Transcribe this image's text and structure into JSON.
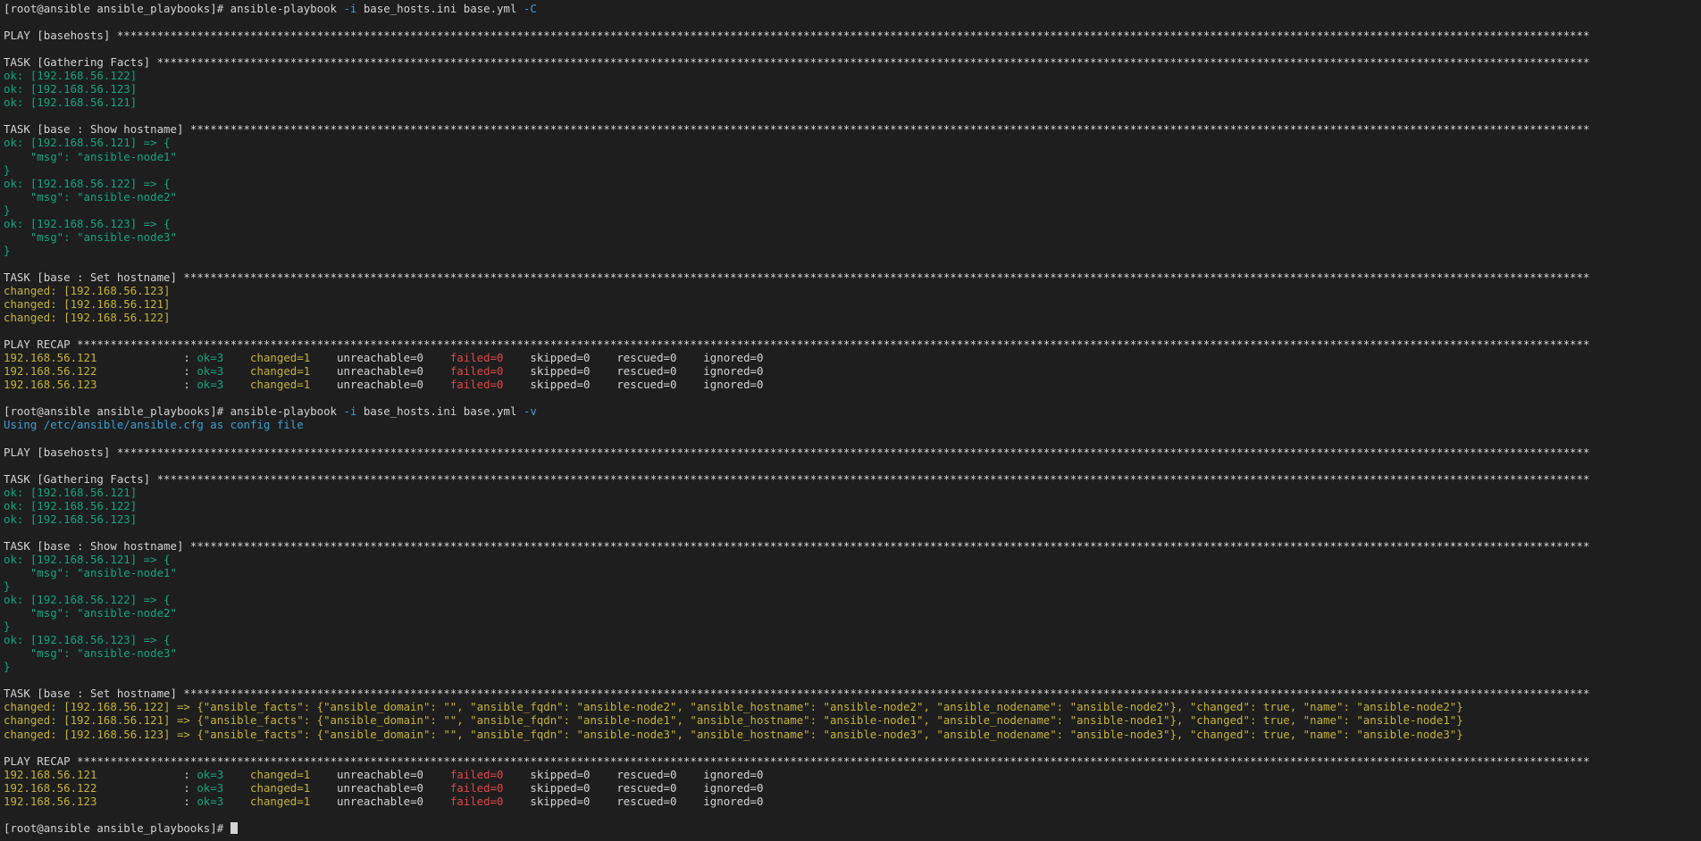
{
  "colors": {
    "background": "#1e1e1e",
    "default": "#d4d4d4",
    "ok": "#13a57e",
    "changed": "#c4b33a",
    "failed": "#e04646",
    "info": "#3a9fd4",
    "flag": "#3a9fd4"
  },
  "terminal": {
    "cursor_icon": "block-cursor-icon",
    "lines": [
      [
        [
          "[root@ansible ansible_playbooks]# ansible-playbook ",
          "default"
        ],
        [
          "-i",
          "flag"
        ],
        [
          " base_hosts.ini base.yml ",
          "default"
        ],
        [
          "-C",
          "flag"
        ]
      ],
      [],
      [
        [
          "PLAY [basehosts] *****************************************************************************************************************************************************************************************************************************",
          "default"
        ]
      ],
      [],
      [
        [
          "TASK [Gathering Facts] ***********************************************************************************************************************************************************************************************************************",
          "default"
        ]
      ],
      [
        [
          "ok: [192.168.56.122]",
          "ok"
        ]
      ],
      [
        [
          "ok: [192.168.56.123]",
          "ok"
        ]
      ],
      [
        [
          "ok: [192.168.56.121]",
          "ok"
        ]
      ],
      [],
      [
        [
          "TASK [base : Show hostname] ******************************************************************************************************************************************************************************************************************",
          "default"
        ]
      ],
      [
        [
          "ok: [192.168.56.121] => {",
          "ok"
        ]
      ],
      [
        [
          "    \"msg\": \"ansible-node1\"",
          "ok"
        ]
      ],
      [
        [
          "}",
          "ok"
        ]
      ],
      [
        [
          "ok: [192.168.56.122] => {",
          "ok"
        ]
      ],
      [
        [
          "    \"msg\": \"ansible-node2\"",
          "ok"
        ]
      ],
      [
        [
          "}",
          "ok"
        ]
      ],
      [
        [
          "ok: [192.168.56.123] => {",
          "ok"
        ]
      ],
      [
        [
          "    \"msg\": \"ansible-node3\"",
          "ok"
        ]
      ],
      [
        [
          "}",
          "ok"
        ]
      ],
      [],
      [
        [
          "TASK [base : Set hostname] *******************************************************************************************************************************************************************************************************************",
          "default"
        ]
      ],
      [
        [
          "changed: [192.168.56.123]",
          "changed"
        ]
      ],
      [
        [
          "changed: [192.168.56.121]",
          "changed"
        ]
      ],
      [
        [
          "changed: [192.168.56.122]",
          "changed"
        ]
      ],
      [],
      [
        [
          "PLAY RECAP ***********************************************************************************************************************************************************************************************************************************",
          "default"
        ]
      ],
      [
        [
          "192.168.56.121",
          "changed"
        ],
        [
          "             : ",
          "default"
        ],
        [
          "ok=3",
          "ok"
        ],
        [
          "    ",
          "default"
        ],
        [
          "changed=1",
          "changed"
        ],
        [
          "    unreachable=0    ",
          "default"
        ],
        [
          "failed=0",
          "failed"
        ],
        [
          "    skipped=0    rescued=0    ignored=0",
          "default"
        ]
      ],
      [
        [
          "192.168.56.122",
          "changed"
        ],
        [
          "             : ",
          "default"
        ],
        [
          "ok=3",
          "ok"
        ],
        [
          "    ",
          "default"
        ],
        [
          "changed=1",
          "changed"
        ],
        [
          "    unreachable=0    ",
          "default"
        ],
        [
          "failed=0",
          "failed"
        ],
        [
          "    skipped=0    rescued=0    ignored=0",
          "default"
        ]
      ],
      [
        [
          "192.168.56.123",
          "changed"
        ],
        [
          "             : ",
          "default"
        ],
        [
          "ok=3",
          "ok"
        ],
        [
          "    ",
          "default"
        ],
        [
          "changed=1",
          "changed"
        ],
        [
          "    unreachable=0    ",
          "default"
        ],
        [
          "failed=0",
          "failed"
        ],
        [
          "    skipped=0    rescued=0    ignored=0",
          "default"
        ]
      ],
      [],
      [
        [
          "[root@ansible ansible_playbooks]# ansible-playbook ",
          "default"
        ],
        [
          "-i",
          "flag"
        ],
        [
          " base_hosts.ini base.yml ",
          "default"
        ],
        [
          "-v",
          "flag"
        ]
      ],
      [
        [
          "Using /etc/ansible/ansible.cfg as config file",
          "info"
        ]
      ],
      [],
      [
        [
          "PLAY [basehosts] *****************************************************************************************************************************************************************************************************************************",
          "default"
        ]
      ],
      [],
      [
        [
          "TASK [Gathering Facts] ***********************************************************************************************************************************************************************************************************************",
          "default"
        ]
      ],
      [
        [
          "ok: [192.168.56.121]",
          "ok"
        ]
      ],
      [
        [
          "ok: [192.168.56.122]",
          "ok"
        ]
      ],
      [
        [
          "ok: [192.168.56.123]",
          "ok"
        ]
      ],
      [],
      [
        [
          "TASK [base : Show hostname] ******************************************************************************************************************************************************************************************************************",
          "default"
        ]
      ],
      [
        [
          "ok: [192.168.56.121] => {",
          "ok"
        ]
      ],
      [
        [
          "    \"msg\": \"ansible-node1\"",
          "ok"
        ]
      ],
      [
        [
          "}",
          "ok"
        ]
      ],
      [
        [
          "ok: [192.168.56.122] => {",
          "ok"
        ]
      ],
      [
        [
          "    \"msg\": \"ansible-node2\"",
          "ok"
        ]
      ],
      [
        [
          "}",
          "ok"
        ]
      ],
      [
        [
          "ok: [192.168.56.123] => {",
          "ok"
        ]
      ],
      [
        [
          "    \"msg\": \"ansible-node3\"",
          "ok"
        ]
      ],
      [
        [
          "}",
          "ok"
        ]
      ],
      [],
      [
        [
          "TASK [base : Set hostname] *******************************************************************************************************************************************************************************************************************",
          "default"
        ]
      ],
      [
        [
          "changed: [192.168.56.122] => {\"ansible_facts\": {\"ansible_domain\": \"\", \"ansible_fqdn\": \"ansible-node2\", \"ansible_hostname\": \"ansible-node2\", \"ansible_nodename\": \"ansible-node2\"}, \"changed\": true, \"name\": \"ansible-node2\"}",
          "changed"
        ]
      ],
      [
        [
          "changed: [192.168.56.121] => {\"ansible_facts\": {\"ansible_domain\": \"\", \"ansible_fqdn\": \"ansible-node1\", \"ansible_hostname\": \"ansible-node1\", \"ansible_nodename\": \"ansible-node1\"}, \"changed\": true, \"name\": \"ansible-node1\"}",
          "changed"
        ]
      ],
      [
        [
          "changed: [192.168.56.123] => {\"ansible_facts\": {\"ansible_domain\": \"\", \"ansible_fqdn\": \"ansible-node3\", \"ansible_hostname\": \"ansible-node3\", \"ansible_nodename\": \"ansible-node3\"}, \"changed\": true, \"name\": \"ansible-node3\"}",
          "changed"
        ]
      ],
      [],
      [
        [
          "PLAY RECAP ***********************************************************************************************************************************************************************************************************************************",
          "default"
        ]
      ],
      [
        [
          "192.168.56.121",
          "changed"
        ],
        [
          "             : ",
          "default"
        ],
        [
          "ok=3",
          "ok"
        ],
        [
          "    ",
          "default"
        ],
        [
          "changed=1",
          "changed"
        ],
        [
          "    unreachable=0    ",
          "default"
        ],
        [
          "failed=0",
          "failed"
        ],
        [
          "    skipped=0    rescued=0    ignored=0",
          "default"
        ]
      ],
      [
        [
          "192.168.56.122",
          "changed"
        ],
        [
          "             : ",
          "default"
        ],
        [
          "ok=3",
          "ok"
        ],
        [
          "    ",
          "default"
        ],
        [
          "changed=1",
          "changed"
        ],
        [
          "    unreachable=0    ",
          "default"
        ],
        [
          "failed=0",
          "failed"
        ],
        [
          "    skipped=0    rescued=0    ignored=0",
          "default"
        ]
      ],
      [
        [
          "192.168.56.123",
          "changed"
        ],
        [
          "             : ",
          "default"
        ],
        [
          "ok=3",
          "ok"
        ],
        [
          "    ",
          "default"
        ],
        [
          "changed=1",
          "changed"
        ],
        [
          "    unreachable=0    ",
          "default"
        ],
        [
          "failed=0",
          "failed"
        ],
        [
          "    skipped=0    rescued=0    ignored=0",
          "default"
        ]
      ],
      [],
      [
        [
          "[root@ansible ansible_playbooks]# ",
          "default"
        ]
      ]
    ]
  }
}
